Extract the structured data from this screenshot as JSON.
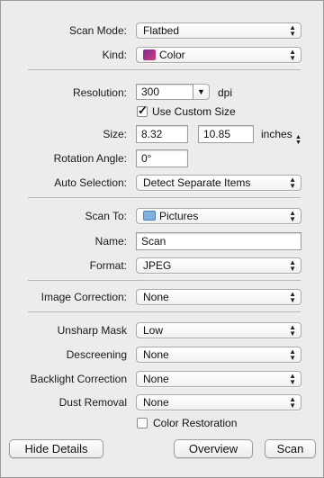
{
  "scan_mode": {
    "label": "Scan Mode:",
    "value": "Flatbed"
  },
  "kind": {
    "label": "Kind:",
    "value": "Color",
    "icon": "color-icon"
  },
  "resolution": {
    "label": "Resolution:",
    "value": "300",
    "unit": "dpi"
  },
  "custom_size": {
    "label": "Use Custom Size",
    "checked": true
  },
  "size": {
    "label": "Size:",
    "width": "8.32",
    "height": "10.85",
    "unit": "inches"
  },
  "rotation": {
    "label": "Rotation Angle:",
    "value": "0°"
  },
  "auto_selection": {
    "label": "Auto Selection:",
    "value": "Detect Separate Items"
  },
  "scan_to": {
    "label": "Scan To:",
    "value": "Pictures",
    "icon": "folder-icon"
  },
  "name": {
    "label": "Name:",
    "value": "Scan"
  },
  "format": {
    "label": "Format:",
    "value": "JPEG"
  },
  "image_correction": {
    "label": "Image Correction:",
    "value": "None"
  },
  "unsharp_mask": {
    "label": "Unsharp Mask",
    "value": "Low"
  },
  "descreening": {
    "label": "Descreening",
    "value": "None"
  },
  "backlight": {
    "label": "Backlight Correction",
    "value": "None"
  },
  "dust_removal": {
    "label": "Dust Removal",
    "value": "None"
  },
  "color_restoration": {
    "label": "Color Restoration",
    "checked": false
  },
  "buttons": {
    "hide_details": "Hide Details",
    "overview": "Overview",
    "scan": "Scan"
  },
  "glyphs": {
    "up": "▲",
    "down": "▼",
    "check": "✓"
  }
}
